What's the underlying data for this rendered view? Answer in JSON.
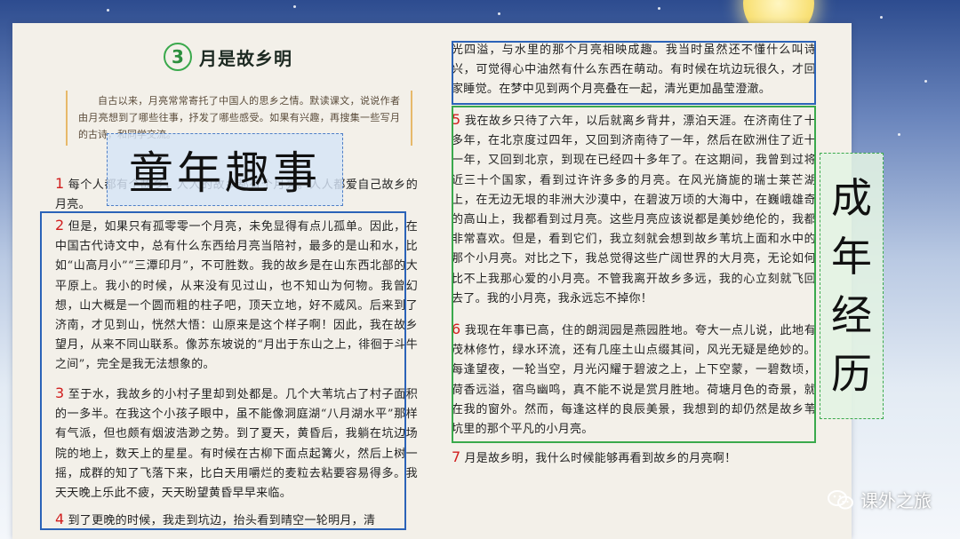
{
  "lesson": {
    "number": "3",
    "title": "月是故乡明"
  },
  "intro": "自古以来，月亮常常寄托了中国人的思乡之情。默读课文，说说作者由月亮想到了哪些往事，抒发了哪些感受。如果有兴趣，再搜集一些写月的古诗，和同学交流。",
  "paragraphs": {
    "p1_num": "1",
    "p1": "每个人都有个故乡，人人的故乡都有个月亮。人人都爱自己故乡的月亮。",
    "p2_num": "2",
    "p2": "但是，如果只有孤零零一个月亮，未免显得有点儿孤单。因此，在中国古代诗文中，总有什么东西给月亮当陪衬，最多的是山和水，比如“山高月小”“三潭印月”，不可胜数。我的故乡是在山东西北部的大平原上。我小的时候，从来没有见过山，也不知山为何物。我曾幻想，山大概是一个圆而粗的柱子吧，顶天立地，好不威风。后来到了济南，才见到山，恍然大悟：山原来是这个样子啊！因此，我在故乡望月，从来不同山联系。像苏东坡说的“月出于东山之上，徘徊于斗牛之间”，完全是我无法想象的。",
    "p3_num": "3",
    "p3": "至于水，我故乡的小村子里却到处都是。几个大苇坑占了村子面积的一多半。在我这个小孩子眼中，虽不能像洞庭湖“八月湖水平”那样有气派，但也颇有烟波浩渺之势。到了夏天，黄昏后，我躺在坑边场院的地上，数天上的星星。有时候在古柳下面点起篝火，然后上树一摇，成群的知了飞落下来，比白天用嚼烂的麦粒去粘要容易得多。我天天晚上乐此不疲，天天盼望黄昏早早来临。",
    "p4_num": "4",
    "p4": "到了更晚的时候，我走到坑边，抬头看到晴空一轮明月，清",
    "p4_cont": "光四溢，与水里的那个月亮相映成趣。我当时虽然还不懂什么叫诗兴，可觉得心中油然有什么东西在萌动。有时候在坑边玩很久，才回家睡觉。在梦中见到两个月亮叠在一起，清光更加晶莹澄澈。",
    "p5_num": "5",
    "p5": "我在故乡只待了六年，以后就离乡背井，漂泊天涯。在济南住了十多年，在北京度过四年，又回到济南待了一年，然后在欧洲住了近十一年，又回到北京，到现在已经四十多年了。在这期间，我曾到过将近三十个国家，看到过许许多多的月亮。在风光旖旎的瑞士莱芒湖上，在无边无垠的非洲大沙漠中，在碧波万顷的大海中，在巍峨雄奇的高山上，我都看到过月亮。这些月亮应该说都是美妙绝伦的，我都非常喜欢。但是，看到它们，我立刻就会想到故乡苇坑上面和水中的那个小月亮。对比之下，我总觉得这些广阔世界的大月亮，无论如何比不上我那心爱的小月亮。不管我离开故乡多远，我的心立刻就飞回去了。我的小月亮，我永远忘不掉你！",
    "p6_num": "6",
    "p6": "我现在年事已高，住的朗润园是燕园胜地。夸大一点儿说，此地有茂林修竹，绿水环流，还有几座土山点缀其间，风光无疑是绝妙的。每逢望夜，一轮当空，月光闪耀于碧波之上，上下空蒙，一碧数顷，荷香远溢，宿鸟幽鸣，真不能不说是赏月胜地。荷塘月色的奇景，就在我的窗外。然而，每逢这样的良辰美景，我想到的却仍然是故乡苇坑里的那个平凡的小月亮。",
    "p7_num": "7",
    "p7": "月是故乡明，我什么时候能够再看到故乡的月亮啊！"
  },
  "labels": {
    "childhood": "童年趣事",
    "adulthood": [
      "成",
      "年",
      "经",
      "历"
    ]
  },
  "watermark": {
    "text": "课外之旅",
    "icon": "wechat-icon"
  },
  "colors": {
    "blue_box": "#2b63b8",
    "green_box": "#3aa94c",
    "para_number": "#d11e1e"
  }
}
